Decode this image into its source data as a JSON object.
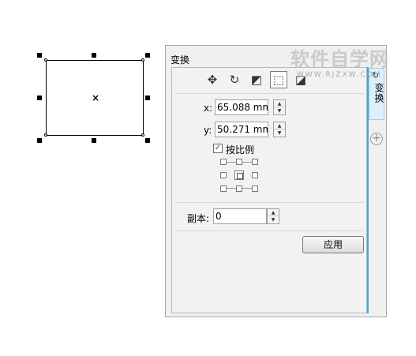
{
  "canvas": {
    "center_marker": "×"
  },
  "docker": {
    "title": "变换",
    "side_tab_label": "变换",
    "side_tab_icon": "↻",
    "add_tab_icon": "+",
    "toolbar": [
      {
        "name": "position-tool",
        "icon": "✥"
      },
      {
        "name": "rotate-tool",
        "icon": "↻"
      },
      {
        "name": "scale-mirror-tool",
        "icon": "◩"
      },
      {
        "name": "size-tool",
        "icon": "⬚"
      },
      {
        "name": "skew-tool",
        "icon": "◪"
      }
    ],
    "x_label": "x:",
    "x_value": "65.088 mm",
    "y_label": "y:",
    "y_value": "50.271 mm",
    "proportional_label": "按比例",
    "proportional_checked": "✓",
    "copies_label": "副本:",
    "copies_value": "0",
    "apply_label": "应用",
    "spin_up": "▲",
    "spin_down": "▼"
  },
  "watermark": {
    "text": "软件自学网",
    "url": "WWW.RJZXW.COM"
  }
}
